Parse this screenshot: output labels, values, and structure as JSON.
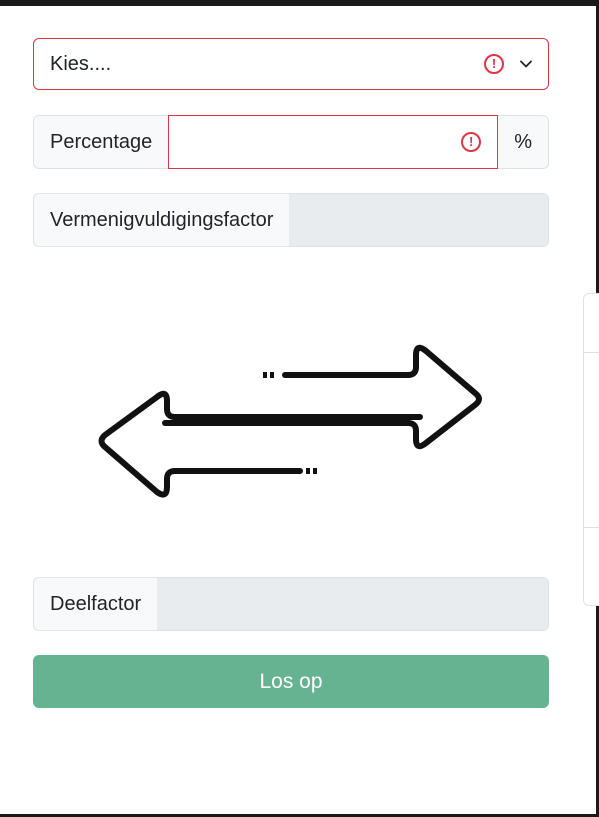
{
  "select": {
    "value": "Kies...."
  },
  "percentage": {
    "label": "Percentage",
    "value": "",
    "unit": "%"
  },
  "multiplier": {
    "label": "Vermenigvuldigingsfactor",
    "value": ""
  },
  "divisor": {
    "label": "Deelfactor",
    "value": ""
  },
  "solve_button": {
    "label": "Los op"
  },
  "colors": {
    "error": "#dc3545",
    "button": "#66b391",
    "addon_bg": "#f8f9fa",
    "readonly_bg": "#e9ecef"
  },
  "icons": {
    "error": "exclamation-circle-icon",
    "dropdown": "chevron-down-icon",
    "swap": "swap-arrows-icon"
  }
}
